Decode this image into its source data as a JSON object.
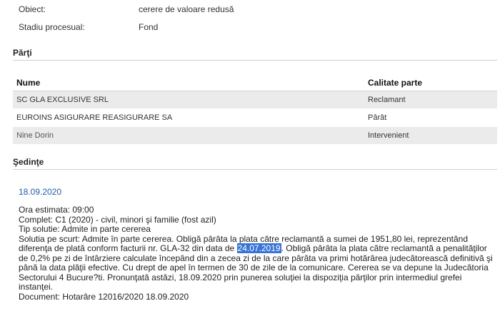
{
  "details": {
    "obiect_label": "Obiect:",
    "obiect_value": "cerere de valoare redusă",
    "stadiu_label": "Stadiu procesual:",
    "stadiu_value": "Fond"
  },
  "parti": {
    "title": "Părţi",
    "col_nume": "Nume",
    "col_calitate": "Calitate parte",
    "rows": [
      {
        "nume": "SC GLA EXCLUSIVE SRL",
        "calitate": "Reclamant"
      },
      {
        "nume": "EUROINS ASIGURARE REASIGURARE SA",
        "calitate": "Pârât"
      },
      {
        "nume": "Nine Dorin",
        "calitate": "Intervenient"
      }
    ]
  },
  "sedinte": {
    "title": "Şedinţe",
    "date": "18.09.2020",
    "ora": "Ora estimata: 09:00",
    "complet": "Complet: C1 (2020) - civil, minori şi familie (fost azil)",
    "tip": "Tip solutie: Admite in parte cererea",
    "sol_l1": "Solutia pe scurt: Admite în parte cererea. Obligă pârâta la plata către reclamantă a sumei de 1951,80 lei, reprezentând",
    "sol_l2_a": "diferenţa de plată conform facturii nr. GLA-32 din data de ",
    "sol_l2_hl": "24.07.2019",
    "sol_l2_b": ". Obligă pârâta la plata către reclamantă a penalităţilor",
    "sol_l3": "de 0,2% pe zi de întârziere calculate începând din a zecea zi de la care pârâta va primi hotărârea judecătorească definitivă şi",
    "sol_l4": "până la data plăţii efective. Cu drept de apel în termen de 30 de zile de la comunicare. Cererea se va depune la Judecătoria",
    "sol_l5": "Sectorului 4 Bucure?ti. Pronunţată astăzi, 18.09.2020 prin punerea soluţiei la dispoziţia părţilor prin intermediul grefei",
    "sol_l6": "instanţei.",
    "document": "Document: Hotarâre  12016/2020  18.09.2020"
  }
}
